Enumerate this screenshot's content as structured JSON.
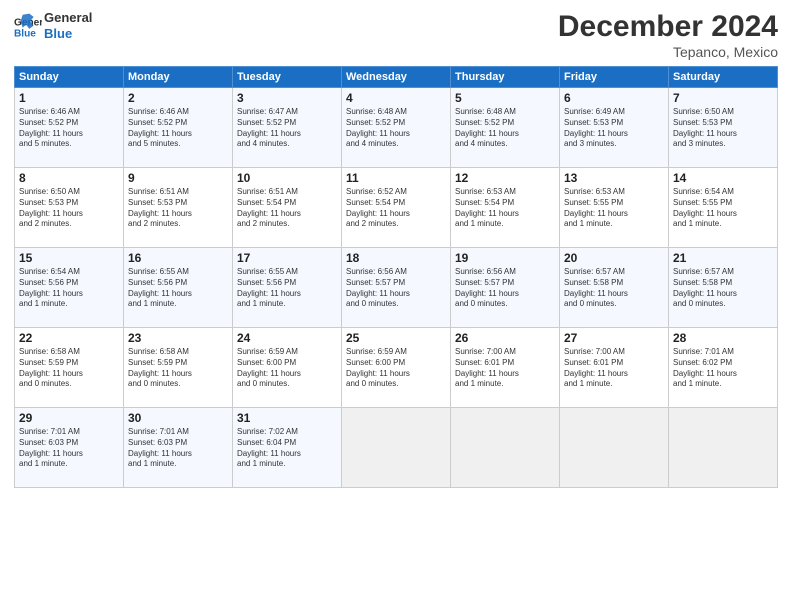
{
  "logo": {
    "line1": "General",
    "line2": "Blue"
  },
  "title": "December 2024",
  "location": "Tepanco, Mexico",
  "days_of_week": [
    "Sunday",
    "Monday",
    "Tuesday",
    "Wednesday",
    "Thursday",
    "Friday",
    "Saturday"
  ],
  "weeks": [
    [
      {
        "day": "1",
        "text": "Sunrise: 6:46 AM\nSunset: 5:52 PM\nDaylight: 11 hours\nand 5 minutes."
      },
      {
        "day": "2",
        "text": "Sunrise: 6:46 AM\nSunset: 5:52 PM\nDaylight: 11 hours\nand 5 minutes."
      },
      {
        "day": "3",
        "text": "Sunrise: 6:47 AM\nSunset: 5:52 PM\nDaylight: 11 hours\nand 4 minutes."
      },
      {
        "day": "4",
        "text": "Sunrise: 6:48 AM\nSunset: 5:52 PM\nDaylight: 11 hours\nand 4 minutes."
      },
      {
        "day": "5",
        "text": "Sunrise: 6:48 AM\nSunset: 5:52 PM\nDaylight: 11 hours\nand 4 minutes."
      },
      {
        "day": "6",
        "text": "Sunrise: 6:49 AM\nSunset: 5:53 PM\nDaylight: 11 hours\nand 3 minutes."
      },
      {
        "day": "7",
        "text": "Sunrise: 6:50 AM\nSunset: 5:53 PM\nDaylight: 11 hours\nand 3 minutes."
      }
    ],
    [
      {
        "day": "8",
        "text": "Sunrise: 6:50 AM\nSunset: 5:53 PM\nDaylight: 11 hours\nand 2 minutes."
      },
      {
        "day": "9",
        "text": "Sunrise: 6:51 AM\nSunset: 5:53 PM\nDaylight: 11 hours\nand 2 minutes."
      },
      {
        "day": "10",
        "text": "Sunrise: 6:51 AM\nSunset: 5:54 PM\nDaylight: 11 hours\nand 2 minutes."
      },
      {
        "day": "11",
        "text": "Sunrise: 6:52 AM\nSunset: 5:54 PM\nDaylight: 11 hours\nand 2 minutes."
      },
      {
        "day": "12",
        "text": "Sunrise: 6:53 AM\nSunset: 5:54 PM\nDaylight: 11 hours\nand 1 minute."
      },
      {
        "day": "13",
        "text": "Sunrise: 6:53 AM\nSunset: 5:55 PM\nDaylight: 11 hours\nand 1 minute."
      },
      {
        "day": "14",
        "text": "Sunrise: 6:54 AM\nSunset: 5:55 PM\nDaylight: 11 hours\nand 1 minute."
      }
    ],
    [
      {
        "day": "15",
        "text": "Sunrise: 6:54 AM\nSunset: 5:56 PM\nDaylight: 11 hours\nand 1 minute."
      },
      {
        "day": "16",
        "text": "Sunrise: 6:55 AM\nSunset: 5:56 PM\nDaylight: 11 hours\nand 1 minute."
      },
      {
        "day": "17",
        "text": "Sunrise: 6:55 AM\nSunset: 5:56 PM\nDaylight: 11 hours\nand 1 minute."
      },
      {
        "day": "18",
        "text": "Sunrise: 6:56 AM\nSunset: 5:57 PM\nDaylight: 11 hours\nand 0 minutes."
      },
      {
        "day": "19",
        "text": "Sunrise: 6:56 AM\nSunset: 5:57 PM\nDaylight: 11 hours\nand 0 minutes."
      },
      {
        "day": "20",
        "text": "Sunrise: 6:57 AM\nSunset: 5:58 PM\nDaylight: 11 hours\nand 0 minutes."
      },
      {
        "day": "21",
        "text": "Sunrise: 6:57 AM\nSunset: 5:58 PM\nDaylight: 11 hours\nand 0 minutes."
      }
    ],
    [
      {
        "day": "22",
        "text": "Sunrise: 6:58 AM\nSunset: 5:59 PM\nDaylight: 11 hours\nand 0 minutes."
      },
      {
        "day": "23",
        "text": "Sunrise: 6:58 AM\nSunset: 5:59 PM\nDaylight: 11 hours\nand 0 minutes."
      },
      {
        "day": "24",
        "text": "Sunrise: 6:59 AM\nSunset: 6:00 PM\nDaylight: 11 hours\nand 0 minutes."
      },
      {
        "day": "25",
        "text": "Sunrise: 6:59 AM\nSunset: 6:00 PM\nDaylight: 11 hours\nand 0 minutes."
      },
      {
        "day": "26",
        "text": "Sunrise: 7:00 AM\nSunset: 6:01 PM\nDaylight: 11 hours\nand 1 minute."
      },
      {
        "day": "27",
        "text": "Sunrise: 7:00 AM\nSunset: 6:01 PM\nDaylight: 11 hours\nand 1 minute."
      },
      {
        "day": "28",
        "text": "Sunrise: 7:01 AM\nSunset: 6:02 PM\nDaylight: 11 hours\nand 1 minute."
      }
    ],
    [
      {
        "day": "29",
        "text": "Sunrise: 7:01 AM\nSunset: 6:03 PM\nDaylight: 11 hours\nand 1 minute."
      },
      {
        "day": "30",
        "text": "Sunrise: 7:01 AM\nSunset: 6:03 PM\nDaylight: 11 hours\nand 1 minute."
      },
      {
        "day": "31",
        "text": "Sunrise: 7:02 AM\nSunset: 6:04 PM\nDaylight: 11 hours\nand 1 minute."
      },
      {
        "day": "",
        "text": ""
      },
      {
        "day": "",
        "text": ""
      },
      {
        "day": "",
        "text": ""
      },
      {
        "day": "",
        "text": ""
      }
    ]
  ]
}
